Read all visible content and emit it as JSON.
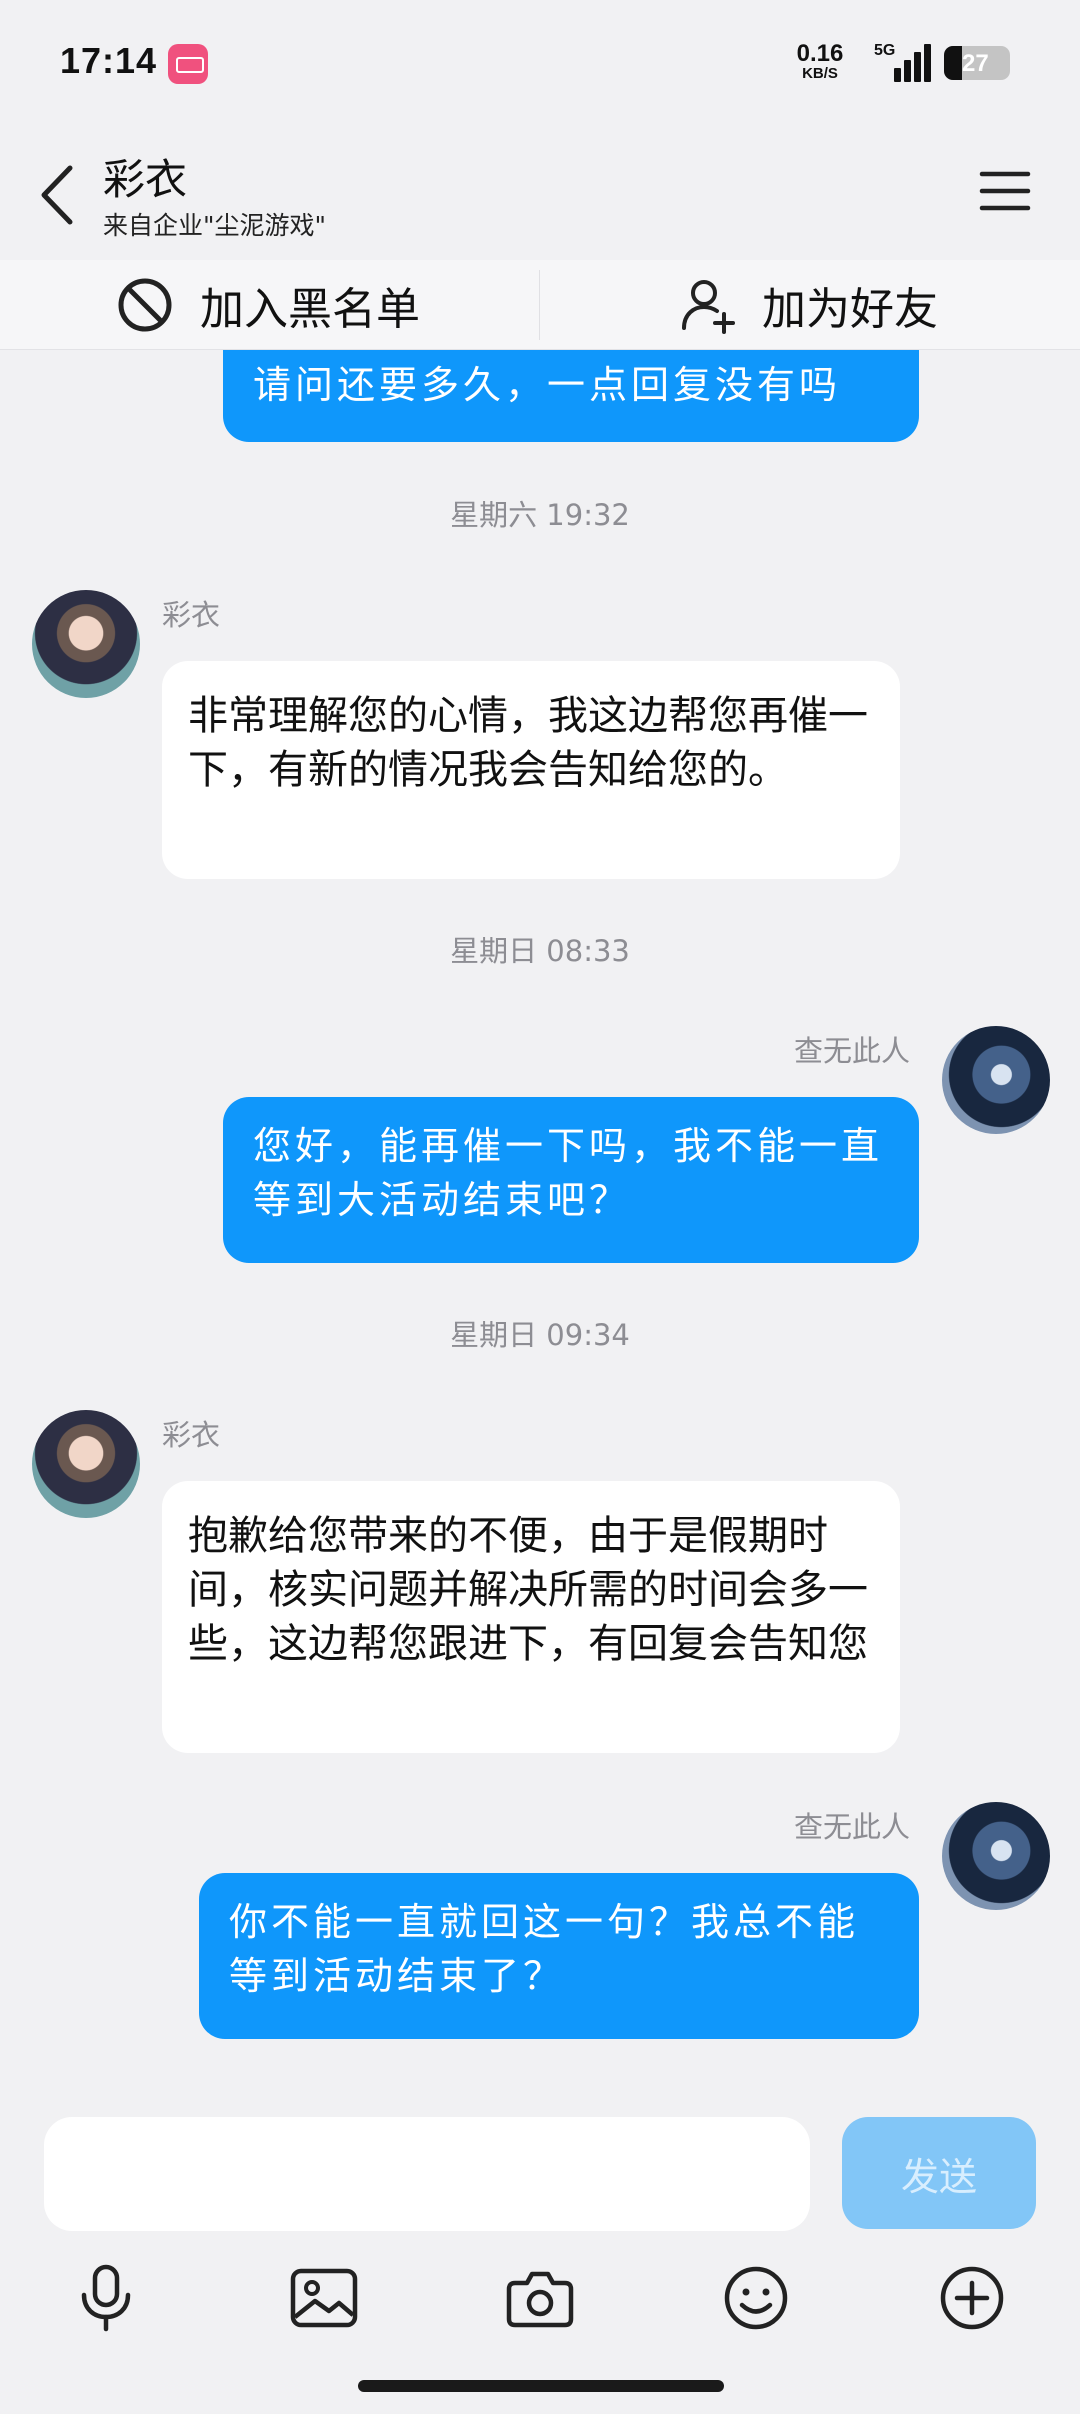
{
  "status_bar": {
    "time": "17:14",
    "net_speed_value": "0.16",
    "net_speed_unit": "KB/S",
    "network": "5G",
    "battery": "27",
    "battery_level": 0.27
  },
  "header": {
    "title": "彩衣",
    "subtitle": "来自企业\"尘泥游戏\""
  },
  "actions": {
    "block_label": "加入黑名单",
    "add_friend_label": "加为好友"
  },
  "messages": [
    {
      "type": "out",
      "text": "请问还要多久，一点回复没有吗"
    },
    {
      "type": "time",
      "text": "星期六 19:32"
    },
    {
      "type": "in",
      "sender": "彩衣",
      "text": "非常理解您的心情，我这边帮您再催一下，有新的情况我会告知给您的。"
    },
    {
      "type": "time",
      "text": "星期日 08:33"
    },
    {
      "type": "out",
      "sender": "查无此人",
      "text": "您好，能再催一下吗，我不能一直等到大活动结束吧？"
    },
    {
      "type": "time",
      "text": "星期日 09:34"
    },
    {
      "type": "in",
      "sender": "彩衣",
      "text": "抱歉给您带来的不便，由于是假期时间，核实问题并解决所需的时间会多一些，这边帮您跟进下，有回复会告知您"
    },
    {
      "type": "out",
      "sender": "查无此人",
      "text": "你不能一直就回这一句？我总不能等到活动结束了？"
    }
  ],
  "composer": {
    "input_value": "",
    "send_label": "发送"
  },
  "toolbar": {
    "icons": [
      "microphone-icon",
      "image-icon",
      "camera-icon",
      "emoji-icon",
      "plus-icon"
    ]
  },
  "colors": {
    "accent": "#0f97fb",
    "send_disabled": "#82c6f7",
    "background": "#f1f1f3"
  }
}
